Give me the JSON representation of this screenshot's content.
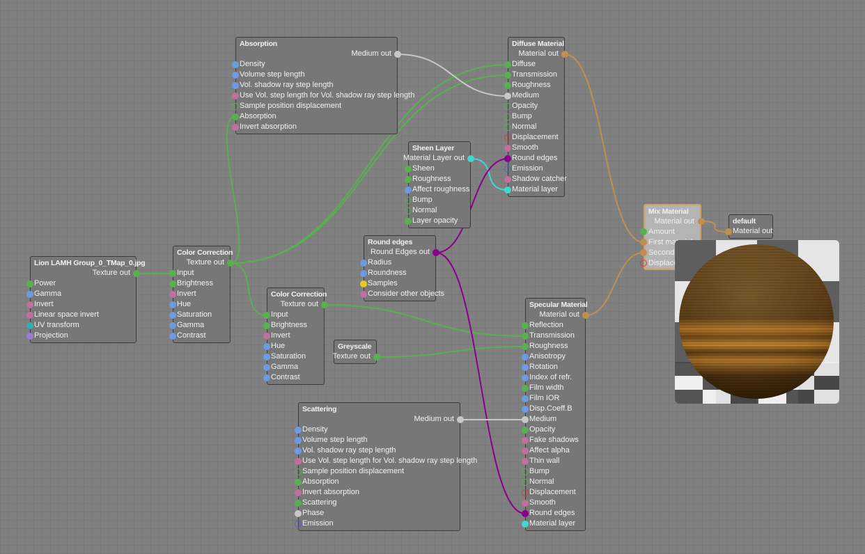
{
  "port_colors": {
    "g": "#58b04f",
    "b": "#6c9be0",
    "p": "#c0709a",
    "gr": "#58b04f",
    "rr": "#d04040",
    "pu": "#8a008a",
    "c": "#40d8d0",
    "y": "#e8c818",
    "w": "#c8c8c8",
    "br": "#5060d0",
    "lv": "#a078d8",
    "t": "#30b0b0",
    "tan": "#c09050"
  },
  "nodes": {
    "absorption": {
      "title": "Absorption",
      "out": "Medium out",
      "out_kind": "w",
      "inputs": [
        [
          "Density",
          "b"
        ],
        [
          "Volume step length",
          "b"
        ],
        [
          "Vol. shadow ray step length",
          "b"
        ],
        [
          "Use Vol. step length for Vol. shadow ray step length",
          "p"
        ],
        [
          "Sample position displacement",
          "gr"
        ],
        [
          "Absorption",
          "g"
        ],
        [
          "Invert absorption",
          "p"
        ]
      ]
    },
    "diffuse": {
      "title": "Diffuse Material",
      "out": "Material out",
      "out_kind": "tan",
      "inputs": [
        [
          "Diffuse",
          "g"
        ],
        [
          "Transmission",
          "g"
        ],
        [
          "Roughness",
          "g"
        ],
        [
          "Medium",
          "w"
        ],
        [
          "Opacity",
          "gr"
        ],
        [
          "Bump",
          "gr"
        ],
        [
          "Normal",
          "gr"
        ],
        [
          "Displacement",
          "rr"
        ],
        [
          "Smooth",
          "p"
        ],
        [
          "Round edges",
          "pu"
        ],
        [
          "Emission",
          "br"
        ],
        [
          "Shadow catcher",
          "p"
        ],
        [
          "Material layer",
          "c"
        ]
      ]
    },
    "sheen": {
      "title": "Sheen Layer",
      "out": "Material Layer out",
      "out_kind": "c",
      "inputs": [
        [
          "Sheen",
          "g"
        ],
        [
          "Roughness",
          "g"
        ],
        [
          "Affect roughness",
          "b"
        ],
        [
          "Bump",
          "gr"
        ],
        [
          "Normal",
          "gr"
        ],
        [
          "Layer opacity",
          "g"
        ]
      ]
    },
    "roundedges": {
      "title": "Round edges",
      "out": "Round Edges out",
      "out_kind": "pu",
      "inputs": [
        [
          "Radius",
          "b"
        ],
        [
          "Roundness",
          "b"
        ],
        [
          "Samples",
          "y"
        ],
        [
          "Consider other objects",
          "p"
        ]
      ]
    },
    "lion": {
      "title": "Lion LAMH Group_0_TMap_0.jpg",
      "out": "Texture out",
      "out_kind": "g",
      "inputs": [
        [
          "Power",
          "g"
        ],
        [
          "Gamma",
          "b"
        ],
        [
          "Invert",
          "p"
        ],
        [
          "Linear space invert",
          "p"
        ],
        [
          "UV transform",
          "t"
        ],
        [
          "Projection",
          "lv"
        ]
      ]
    },
    "cc1": {
      "title": "Color Correction",
      "out": "Texture out",
      "out_kind": "g",
      "inputs": [
        [
          "Input",
          "g"
        ],
        [
          "Brightness",
          "g"
        ],
        [
          "Invert",
          "p"
        ],
        [
          "Hue",
          "b"
        ],
        [
          "Saturation",
          "b"
        ],
        [
          "Gamma",
          "b"
        ],
        [
          "Contrast",
          "b"
        ]
      ]
    },
    "cc2": {
      "title": "Color Correction",
      "out": "Texture out",
      "out_kind": "g",
      "inputs": [
        [
          "Input",
          "g"
        ],
        [
          "Brightness",
          "g"
        ],
        [
          "Invert",
          "p"
        ],
        [
          "Hue",
          "b"
        ],
        [
          "Saturation",
          "b"
        ],
        [
          "Gamma",
          "b"
        ],
        [
          "Contrast",
          "b"
        ]
      ]
    },
    "greyscale": {
      "title": "Greyscale",
      "out": "Texture out",
      "out_kind": "g",
      "inputs": []
    },
    "specular": {
      "title": "Specular Material",
      "out": "Material out",
      "out_kind": "tan",
      "inputs": [
        [
          "Reflection",
          "g"
        ],
        [
          "Transmission",
          "g"
        ],
        [
          "Roughness",
          "g"
        ],
        [
          "Anisotropy",
          "b"
        ],
        [
          "Rotation",
          "b"
        ],
        [
          "Index of refr.",
          "b"
        ],
        [
          "Film width",
          "g"
        ],
        [
          "Film IOR",
          "b"
        ],
        [
          "Disp.Coeff.B",
          "b"
        ],
        [
          "Medium",
          "w"
        ],
        [
          "Opacity",
          "g"
        ],
        [
          "Fake shadows",
          "p"
        ],
        [
          "Affect alpha",
          "p"
        ],
        [
          "Thin wall",
          "p"
        ],
        [
          "Bump",
          "gr"
        ],
        [
          "Normal",
          "gr"
        ],
        [
          "Displacement",
          "rr"
        ],
        [
          "Smooth",
          "p"
        ],
        [
          "Round edges",
          "pu"
        ],
        [
          "Material layer",
          "c"
        ]
      ]
    },
    "scattering": {
      "title": "Scattering",
      "out": "Medium out",
      "out_kind": "w",
      "inputs": [
        [
          "Density",
          "b"
        ],
        [
          "Volume step length",
          "b"
        ],
        [
          "Vol. shadow ray step length",
          "b"
        ],
        [
          "Use Vol. step length for Vol. shadow ray step length",
          "p"
        ],
        [
          "Sample position displacement",
          "gr"
        ],
        [
          "Absorption",
          "g"
        ],
        [
          "Invert absorption",
          "p"
        ],
        [
          "Scattering",
          "g"
        ],
        [
          "Phase",
          "w"
        ],
        [
          "Emission",
          "br"
        ]
      ]
    },
    "mix": {
      "title": "Mix Material",
      "out": "Material out",
      "out_kind": "tan",
      "selected": true,
      "inputs": [
        [
          "Amount",
          "g"
        ],
        [
          "First material",
          "tan"
        ],
        [
          "Second material",
          "tan"
        ],
        [
          "Displacement",
          "rr"
        ]
      ]
    },
    "default": {
      "title": "default",
      "out": null,
      "inputs": [
        [
          "Material out",
          "tan"
        ]
      ]
    }
  },
  "connections": [
    [
      "lion",
      "cc1",
      0,
      "g"
    ],
    [
      "cc1",
      "absorption",
      5,
      "g"
    ],
    [
      "cc1",
      "diffuse",
      0,
      "g"
    ],
    [
      "cc1",
      "diffuse",
      1,
      "g"
    ],
    [
      "cc1",
      "cc2",
      0,
      "g"
    ],
    [
      "cc2",
      "specular",
      1,
      "g"
    ],
    [
      "greyscale",
      "specular",
      2,
      "g"
    ],
    [
      "absorption",
      "diffuse",
      3,
      "w"
    ],
    [
      "sheen",
      "diffuse",
      12,
      "c"
    ],
    [
      "roundedges",
      "diffuse",
      9,
      "pu"
    ],
    [
      "roundedges",
      "specular",
      18,
      "pu"
    ],
    [
      "scattering",
      "specular",
      9,
      "w"
    ],
    [
      "diffuse",
      "mix",
      1,
      "tan"
    ],
    [
      "specular",
      "mix",
      2,
      "tan"
    ],
    [
      "mix",
      "default",
      0,
      "tan"
    ]
  ]
}
